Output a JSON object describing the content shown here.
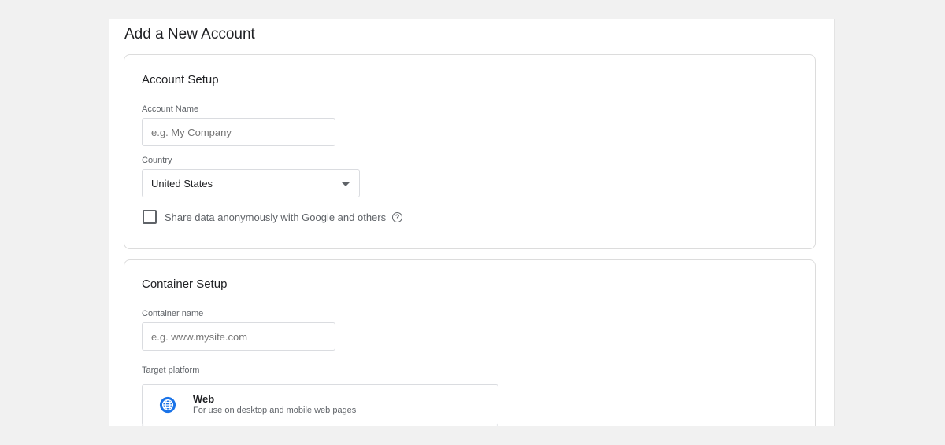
{
  "page": {
    "title": "Add a New Account"
  },
  "account_setup": {
    "title": "Account Setup",
    "account_name_label": "Account Name",
    "account_name_placeholder": "e.g. My Company",
    "account_name_value": "",
    "country_label": "Country",
    "country_value": "United States",
    "share_data_label": "Share data anonymously with Google and others",
    "share_data_checked": false
  },
  "container_setup": {
    "title": "Container Setup",
    "container_name_label": "Container name",
    "container_name_placeholder": "e.g. www.mysite.com",
    "container_name_value": "",
    "target_platform_label": "Target platform",
    "platforms": [
      {
        "name": "Web",
        "description": "For use on desktop and mobile web pages",
        "icon": "globe-icon"
      }
    ]
  },
  "colors": {
    "accent": "#1a73e8",
    "background": "#f1f1f1",
    "border": "#dadce0"
  }
}
